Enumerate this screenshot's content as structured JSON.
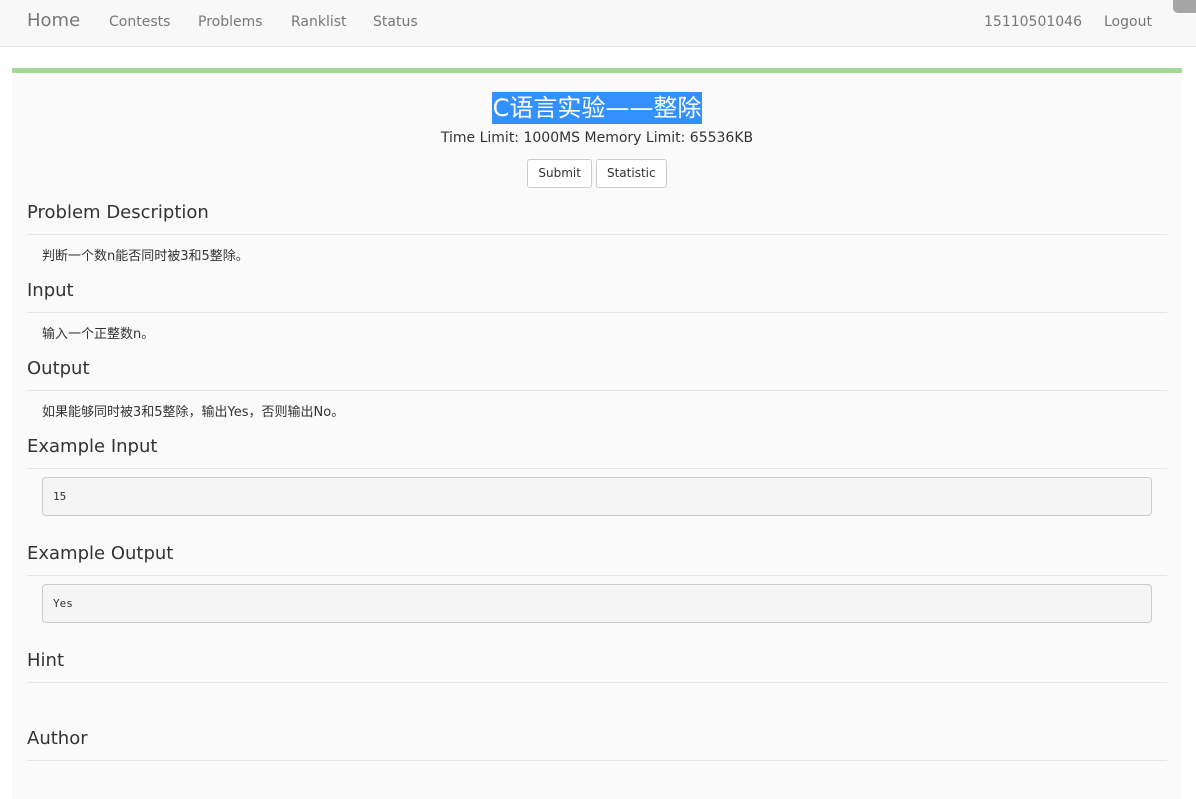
{
  "navbar": {
    "brand": "Home",
    "links": [
      "Contests",
      "Problems",
      "Ranklist",
      "Status"
    ],
    "user": "15110501046",
    "logout": "Logout"
  },
  "problem": {
    "title": "C语言实验——整除",
    "limits": "Time Limit: 1000MS Memory Limit: 65536KB",
    "buttons": {
      "submit": "Submit",
      "statistic": "Statistic"
    },
    "sections": {
      "description_heading": "Problem Description",
      "description_text": "判断一个数n能否同时被3和5整除。",
      "input_heading": "Input",
      "input_text": "输入一个正整数n。",
      "output_heading": "Output",
      "output_text": "如果能够同时被3和5整除，输出Yes，否则输出No。",
      "example_input_heading": "Example Input",
      "example_input": "15",
      "example_output_heading": "Example Output",
      "example_output": "Yes",
      "hint_heading": "Hint",
      "author_heading": "Author"
    }
  },
  "colors": {
    "accent_bar": "#a3d895",
    "selection": "#3390ff",
    "navbar_bg": "#f8f8f8",
    "page_bg": "#fafafa"
  }
}
